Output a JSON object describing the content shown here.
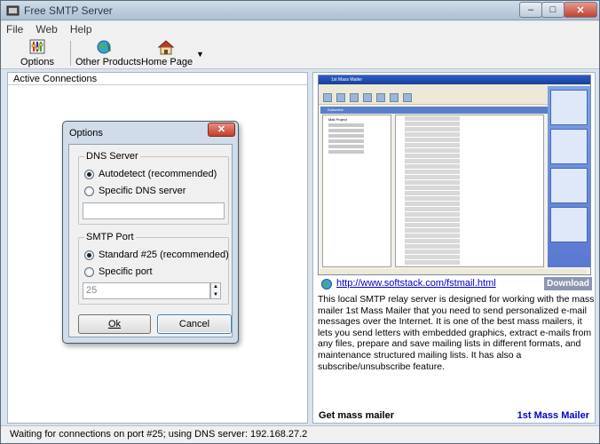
{
  "window": {
    "title": "Free SMTP Server",
    "caption_buttons": {
      "minimize": "–",
      "maximize": "□",
      "close": "✕"
    }
  },
  "menu": {
    "items": [
      "File",
      "Web",
      "Help"
    ]
  },
  "toolbar": {
    "options_label": "Options",
    "products_label": "Other Products",
    "home_label": "Home Page",
    "dropdown": "▼",
    "icons": [
      "options-icon",
      "globe-icon",
      "home-icon",
      "chevron-down-icon"
    ]
  },
  "left_pane": {
    "header": "Active Connections"
  },
  "right_pane": {
    "link": "http://www.softstack.com/fstmail.html",
    "download": "Download",
    "description": "This local SMTP relay server is designed for working with the mass mailer 1st Mass Mailer that you need to send personalized e-mail messages over the Internet. It is one of the best mass mailers, it lets you send letters with embedded graphics, extract e-mails from any files, prepare and save mailing lists in different formats, and maintenance structured mailing lists. It has also a subscribe/unsubscribe feature.",
    "get_label": "Get mass mailer",
    "product_name": "1st Mass Mailer",
    "preview": {
      "title": "1st Mass Mailer",
      "subscribe_bar": "Subscribe",
      "root_node": "Mail Project"
    }
  },
  "status": {
    "text": "Waiting for connections on port #25; using DNS server: 192.168.27.2"
  },
  "dialog": {
    "title": "Options",
    "close": "✕",
    "dns_group_label": "DNS Server",
    "dns_autodetect": "Autodetect (recommended)",
    "dns_specific": "Specific DNS server",
    "dns_value": "",
    "smtp_group_label": "SMTP Port",
    "smtp_standard": "Standard #25 (recommended)",
    "smtp_specific": "Specific port",
    "port_value": "25",
    "ok": "Ok",
    "cancel": "Cancel",
    "selected_dns": "autodetect",
    "selected_port": "standard"
  },
  "colors": {
    "accent": "#0000cc",
    "download_bg": "#8c96ae",
    "chrome": "#d9e4ee"
  }
}
